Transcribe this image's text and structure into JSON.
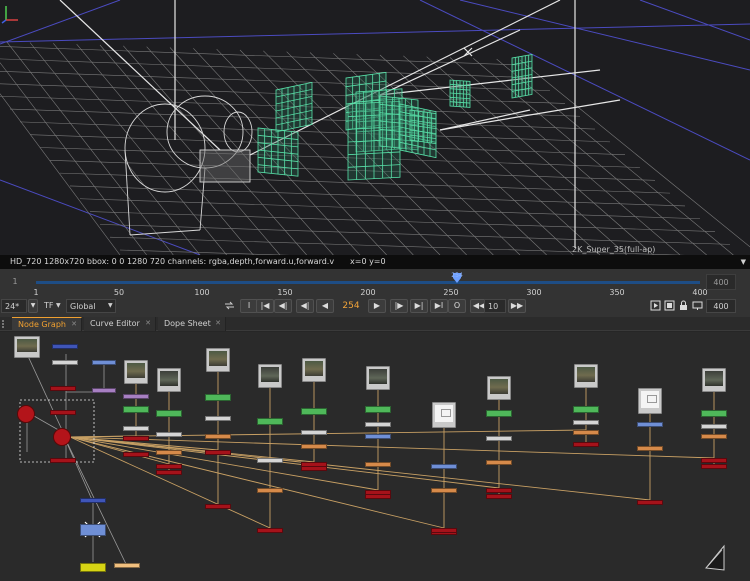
{
  "viewer": {
    "format_label": "2K_Super_35(full-ap)"
  },
  "info_bar": {
    "info": "HD_720 1280x720  bbox: 0 0 1280 720 channels: rgba,depth,forward.u,forward.v",
    "coords": "x=0 y=0",
    "arrow": "▼"
  },
  "timeline": {
    "start": "1",
    "end": "400",
    "ticks": [
      "1",
      "50",
      "100",
      "150",
      "200",
      "250",
      "300",
      "350",
      "400"
    ],
    "current_frame_marker": "254",
    "fps": "24*",
    "tf": "TF",
    "scope": "Global",
    "current_frame": "254",
    "increment": "10",
    "end_field": "400",
    "buttons": {
      "first": "I",
      "prev_key": "|◀",
      "prev_inc": "◀|",
      "prev_frame": "◀|",
      "play_back": "◀",
      "play_fwd": "▶",
      "next_frame": "|▶",
      "next_inc": "▶|",
      "last": "▶I",
      "stop": "O",
      "inc_back": "◀◀",
      "inc_fwd": "▶▶"
    }
  },
  "tabs": [
    {
      "label": "Node Graph",
      "close": "✕"
    },
    {
      "label": "Curve Editor",
      "close": "✕"
    },
    {
      "label": "Dope Sheet",
      "close": "✕"
    }
  ],
  "colors": {
    "accent": "#f0a030",
    "timeline_band": "#1e4d85",
    "card_wire": "#58e0a8",
    "grid": "#7e7e7e",
    "guides": "#5252c8",
    "connection": "#c8a064"
  }
}
